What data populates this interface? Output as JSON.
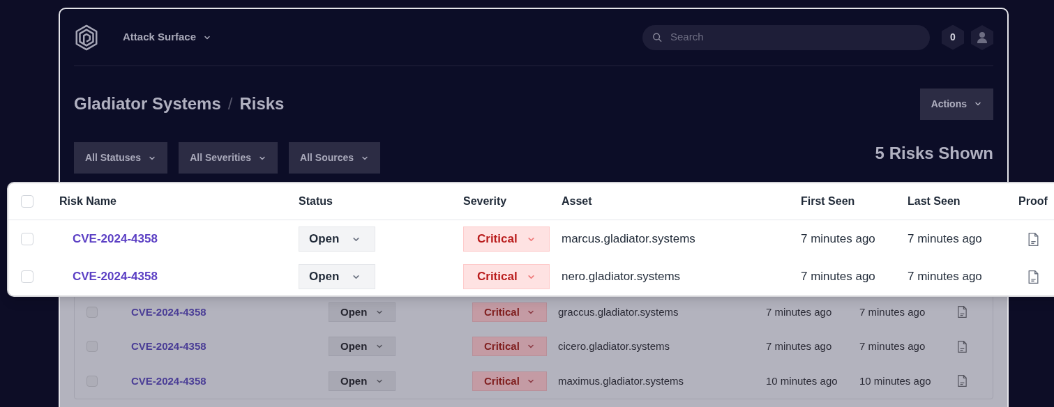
{
  "header": {
    "product_menu": "Attack Surface",
    "search": {
      "placeholder": "Search"
    },
    "notification_count": "0"
  },
  "breadcrumb": [
    "Gladiator Systems",
    "Risks"
  ],
  "breadcrumb_separator": "/",
  "actions_button": "Actions",
  "filters": [
    "All Statuses",
    "All Severities",
    "All Sources"
  ],
  "risk_count": "5 Risks Shown",
  "magnified_table": {
    "select_all_checked": false,
    "columns": [
      "Risk Name",
      "Status",
      "Severity",
      "Asset",
      "First Seen",
      "Last Seen",
      "Proof"
    ],
    "rows": [
      {
        "risk_name": "CVE-2024-4358",
        "status": "Open",
        "severity": "Critical",
        "asset": "marcus.gladiator.systems",
        "first_seen": "7 minutes ago",
        "last_seen": "7 minutes ago",
        "checked": false
      },
      {
        "risk_name": "CVE-2024-4358",
        "status": "Open",
        "severity": "Critical",
        "asset": "nero.gladiator.systems",
        "first_seen": "7 minutes ago",
        "last_seen": "7 minutes ago",
        "checked": false
      }
    ]
  },
  "dimmed_table": {
    "rows": [
      {
        "risk_name": "CVE-2024-4358",
        "status": "Open",
        "severity": "Critical",
        "asset": "graccus.gladiator.systems",
        "first_seen": "7 minutes ago",
        "last_seen": "7 minutes ago",
        "checked": false
      },
      {
        "risk_name": "CVE-2024-4358",
        "status": "Open",
        "severity": "Critical",
        "asset": "cicero.gladiator.systems",
        "first_seen": "7 minutes ago",
        "last_seen": "7 minutes ago",
        "checked": false
      },
      {
        "risk_name": "CVE-2024-4358",
        "status": "Open",
        "severity": "Critical",
        "asset": "maximus.gladiator.systems",
        "first_seen": "10 minutes ago",
        "last_seen": "10 minutes ago",
        "checked": false
      }
    ]
  }
}
